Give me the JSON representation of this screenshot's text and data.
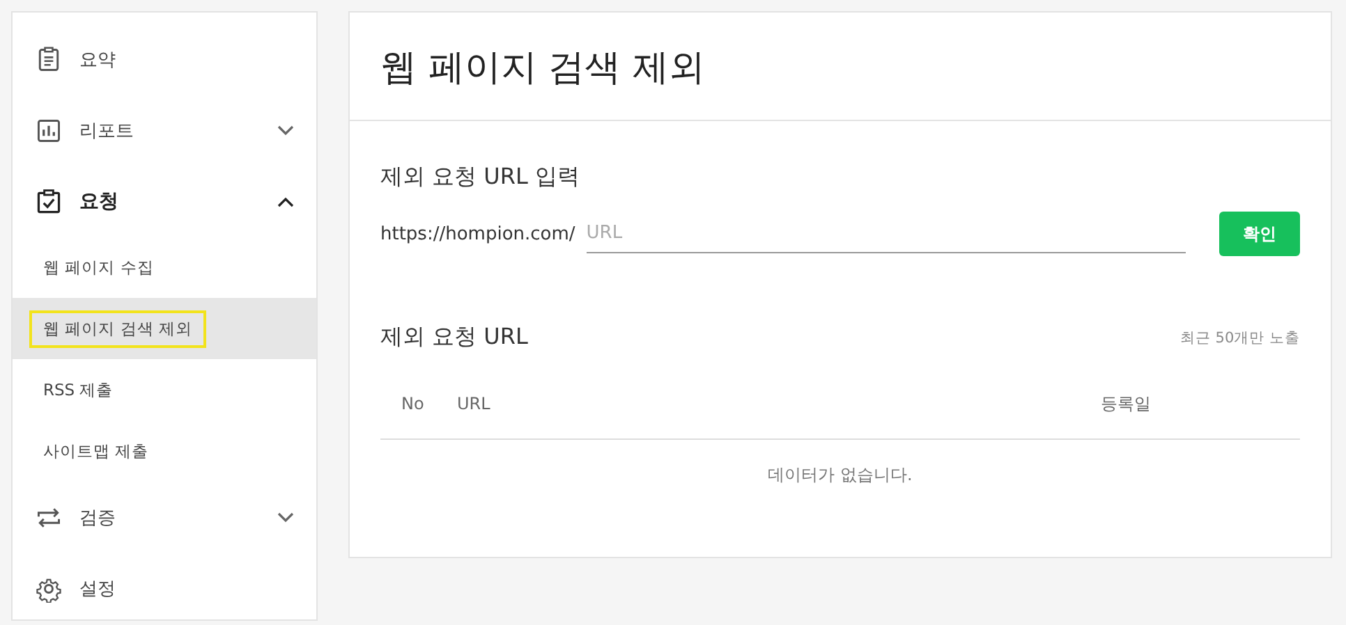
{
  "sidebar": {
    "items": [
      {
        "label": "요약",
        "active": false
      },
      {
        "label": "리포트",
        "active": false,
        "expanded": false
      },
      {
        "label": "요청",
        "active": true,
        "expanded": true,
        "children": [
          {
            "label": "웹 페이지 수집",
            "selected": false,
            "highlighted": false
          },
          {
            "label": "웹 페이지 검색 제외",
            "selected": true,
            "highlighted": true
          },
          {
            "label": "RSS 제출",
            "selected": false,
            "highlighted": false
          },
          {
            "label": "사이트맵 제출",
            "selected": false,
            "highlighted": false
          }
        ]
      },
      {
        "label": "검증",
        "active": false,
        "expanded": false
      },
      {
        "label": "설정",
        "active": false
      }
    ]
  },
  "page": {
    "title": "웹 페이지 검색 제외",
    "form": {
      "heading": "제외 요청 URL 입력",
      "prefix": "https://hompion.com/",
      "placeholder": "URL",
      "button": "확인"
    },
    "list": {
      "heading": "제외 요청 URL",
      "note": "최근 50개만 노출",
      "columns": [
        "No",
        "URL",
        "등록일"
      ],
      "empty": "데이터가 없습니다."
    }
  }
}
